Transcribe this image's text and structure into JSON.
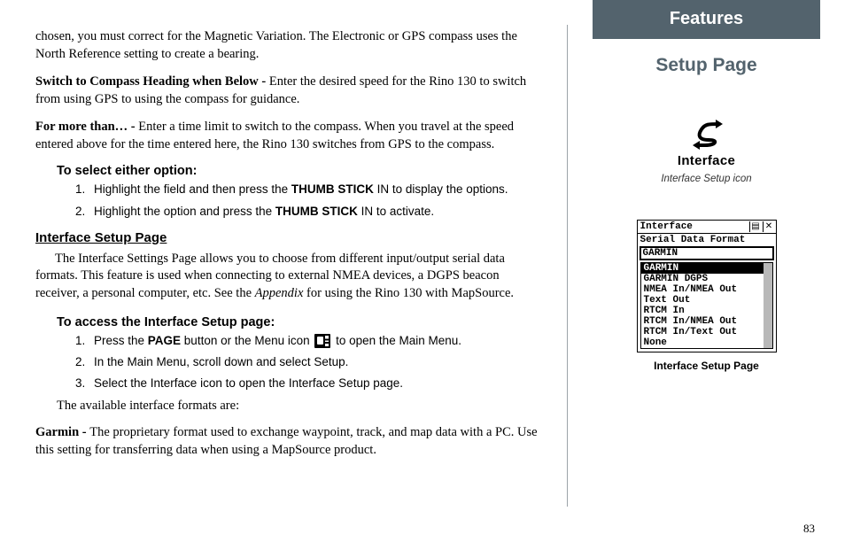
{
  "left": {
    "para1a": "chosen, you must correct for the Magnetic Variation.  The Electronic or GPS compass uses the North Reference setting to create a bearing.",
    "para2_bold": "Switch to Compass Heading when Below - ",
    "para2_rest": "Enter the desired speed for the Rino 130 to switch from using GPS to using the compass for guidance.",
    "para3_bold": "For more than… - ",
    "para3_rest": "Enter a time limit to switch to the compass.  When you travel at the speed entered above for the time entered here, the Rino 130 switches from GPS to the compass.",
    "opt_heading": "To select either option:",
    "opt1_a": "Highlight the field and then press the ",
    "opt1_caps": "THUMB STICK",
    "opt1_b": " IN to display the options.",
    "opt2_a": "Highlight the option and press the ",
    "opt2_caps": "THUMB STICK",
    "opt2_b": " IN to activate.",
    "iface_heading": "Interface Setup Page",
    "iface_para_a": "The Interface Settings Page allows you to choose from different input/output serial data formats.  This feature is used when connecting to external NMEA devices, a DGPS beacon receiver, a personal computer, etc.  See the ",
    "iface_para_i": "Appendix",
    "iface_para_b": " for using the Rino 130 with MapSource.",
    "access_heading": "To access the Interface Setup page:",
    "acc1_a": "Press the ",
    "acc1_caps": "PAGE",
    "acc1_b": " button or the Menu icon ",
    "acc1_c": " to open the Main Menu.",
    "acc2": "In the Main Menu, scroll down and select Setup.",
    "acc3": "Select the Interface icon to open the Interface Setup page.",
    "avail": "The available interface formats are:",
    "garmin_bold": "Garmin - ",
    "garmin_rest": "The proprietary format used to exchange waypoint, track, and map data with a PC.  Use this setting for transferring data when using a MapSource product."
  },
  "right": {
    "features": "Features",
    "setup": "Setup Page",
    "iface_icon_label": "Interface",
    "iface_icon_caption": "Interface Setup icon",
    "device": {
      "title": "Interface",
      "subtitle": "Serial Data Format",
      "selected": "GARMIN",
      "options": [
        "GARMIN",
        "GARMIN DGPS",
        "NMEA In/NMEA Out",
        "Text Out",
        "RTCM In",
        "RTCM In/NMEA Out",
        "RTCM In/Text Out",
        "None"
      ]
    },
    "device_caption": "Interface Setup Page"
  },
  "page_number": "83"
}
